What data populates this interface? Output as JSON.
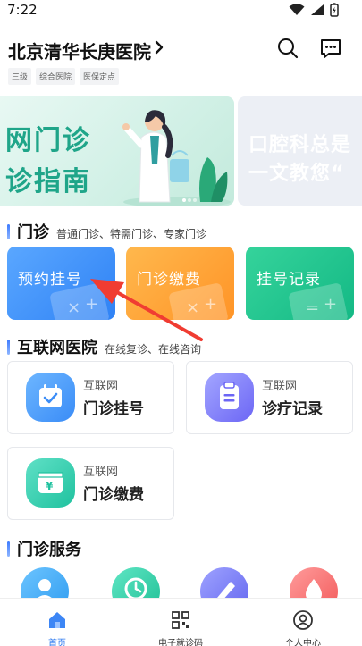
{
  "status": {
    "time": "7:22"
  },
  "header": {
    "hospital_name": "北京清华长庚医院",
    "tags": [
      "三级",
      "综合医院",
      "医保定点"
    ]
  },
  "banner": {
    "line1": "网门诊",
    "line2": "诊指南",
    "next_line1": "口腔科总是",
    "next_line2": "一文教您“"
  },
  "outpatient": {
    "title": "门诊",
    "subtitle": "普通门诊、特需门诊、专家门诊",
    "buttons": [
      {
        "label": "预约挂号",
        "color": "#3b8ef8"
      },
      {
        "label": "门诊缴费",
        "color": "#ffa533"
      },
      {
        "label": "挂号记录",
        "color": "#22c691"
      }
    ]
  },
  "internet": {
    "title": "互联网医院",
    "subtitle": "在线复诊、在线咨询",
    "cards": [
      {
        "small": "互联网",
        "big": "门诊挂号",
        "icon": "calendar-check-icon",
        "color": "#4a9bff"
      },
      {
        "small": "互联网",
        "big": "诊疗记录",
        "icon": "clipboard-icon",
        "color": "#7b76ff"
      },
      {
        "small": "互联网",
        "big": "门诊缴费",
        "icon": "wallet-yen-icon",
        "color": "#2fd0b2"
      }
    ]
  },
  "services": {
    "title": "门诊服务",
    "icons": [
      {
        "name": "person-service-icon",
        "color": "#3fa9f5"
      },
      {
        "name": "clock-service-icon",
        "color": "#2dcfa7"
      },
      {
        "name": "pen-service-icon",
        "color": "#7a7cf5"
      },
      {
        "name": "drop-service-icon",
        "color": "#ff7a7a"
      }
    ]
  },
  "tabbar": {
    "items": [
      {
        "label": "首页",
        "icon": "home-icon",
        "active": true
      },
      {
        "label": "电子就诊码",
        "icon": "qr-code-icon",
        "active": false
      },
      {
        "label": "个人中心",
        "icon": "profile-icon",
        "active": false
      }
    ]
  }
}
